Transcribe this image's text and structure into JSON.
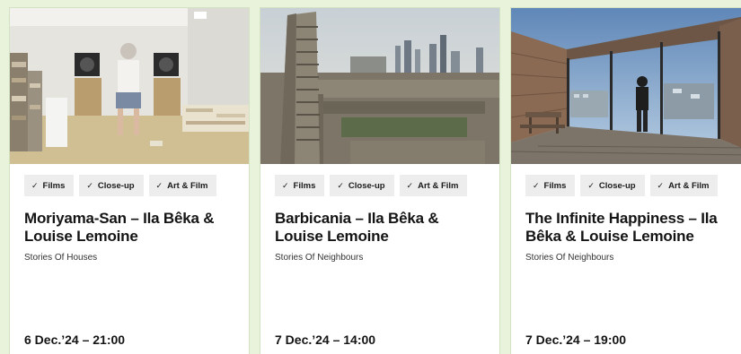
{
  "events": [
    {
      "tags": [
        "Films",
        "Close-up",
        "Art & Film"
      ],
      "title": "Moriyama-San – Ila Bêka & Louise Lemoine",
      "subtitle": "Stories Of Houses",
      "date": "6 Dec.’24 – 21:00"
    },
    {
      "tags": [
        "Films",
        "Close-up",
        "Art & Film"
      ],
      "title": "Barbicania – Ila Bêka & Louise Lemoine",
      "subtitle": "Stories Of Neighbours",
      "date": "7 Dec.’24 – 14:00"
    },
    {
      "tags": [
        "Films",
        "Close-up",
        "Art & Film"
      ],
      "title": "The Infinite Happiness – Ila Bêka & Louise Lemoine",
      "subtitle": "Stories Of Neighbours",
      "date": "7 Dec.’24 – 19:00"
    }
  ],
  "icons": {
    "tag_check": "✓"
  },
  "colors": {
    "page_background": "#e9f3dc",
    "tag_background": "#ededed",
    "text": "#141414"
  }
}
